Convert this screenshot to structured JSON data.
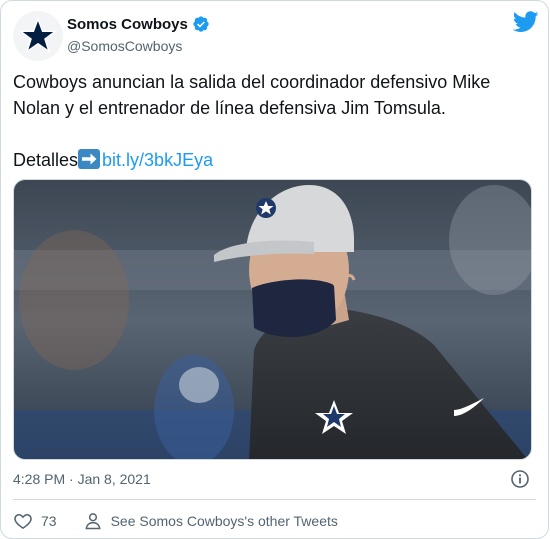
{
  "account": {
    "display_name": "Somos Cowboys",
    "handle": "@SomosCowboys",
    "verified": true
  },
  "tweet": {
    "text": "Cowboys anuncian la salida del coordinador defensivo Mike Nolan y el entrenador de línea defensiva Jim Tomsula.",
    "detail_prefix": "Detalles",
    "link": "bit.ly/3bkJEya",
    "timestamp": "4:28 PM · Jan 8, 2021"
  },
  "actions": {
    "like_count": "73",
    "other_tweets_label": "See Somos Cowboys's other Tweets"
  },
  "colors": {
    "twitter_blue": "#1d9bf0",
    "cowboys_navy": "#041e42",
    "text_secondary": "#536471"
  },
  "icons": [
    "star-logo-icon",
    "verified-badge-icon",
    "twitter-bird-icon",
    "right-arrow-emoji-icon",
    "info-icon",
    "heart-icon",
    "person-icon"
  ]
}
